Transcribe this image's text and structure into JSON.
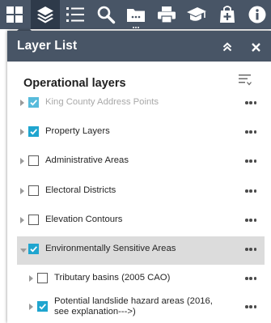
{
  "toolbar": {
    "tools": [
      {
        "icon": "grid-icon",
        "active": false
      },
      {
        "icon": "layers-icon",
        "active": true
      },
      {
        "icon": "legend-list-icon",
        "active": false
      },
      {
        "icon": "search-icon",
        "active": false
      },
      {
        "icon": "folder-icon",
        "active": false
      },
      {
        "icon": "print-icon",
        "active": false
      },
      {
        "icon": "graduation-cap-icon",
        "active": false
      },
      {
        "icon": "bag-add-icon",
        "active": false
      },
      {
        "icon": "info-icon",
        "active": false
      }
    ]
  },
  "panel": {
    "title": "Layer List",
    "subheader": "Operational layers"
  },
  "layers": [
    {
      "label": "King County Address Points",
      "checked": true,
      "expanded": false,
      "faded": true
    },
    {
      "label": "Property Layers",
      "checked": true,
      "expanded": false,
      "faded": false
    },
    {
      "label": "Administrative Areas",
      "checked": false,
      "expanded": false,
      "faded": false
    },
    {
      "label": "Electoral Districts",
      "checked": false,
      "expanded": false,
      "faded": false
    },
    {
      "label": "Elevation Contours",
      "checked": false,
      "expanded": false,
      "faded": false
    },
    {
      "label": "Environmentally Sensitive Areas",
      "checked": true,
      "expanded": true,
      "faded": false,
      "selected": true
    },
    {
      "label": "Tributary basins (2005 CAO)",
      "checked": false,
      "expanded": false,
      "faded": false
    },
    {
      "label": "Potential landslide hazard areas (2016, see explanation--->)",
      "checked": true,
      "expanded": false,
      "faded": false
    }
  ],
  "colors": {
    "toolbar_bg": "#485566",
    "toolbar_active": "#2e3a4a",
    "checkbox_on": "#1fa5cf",
    "selected_row": "#dcdcdc"
  }
}
